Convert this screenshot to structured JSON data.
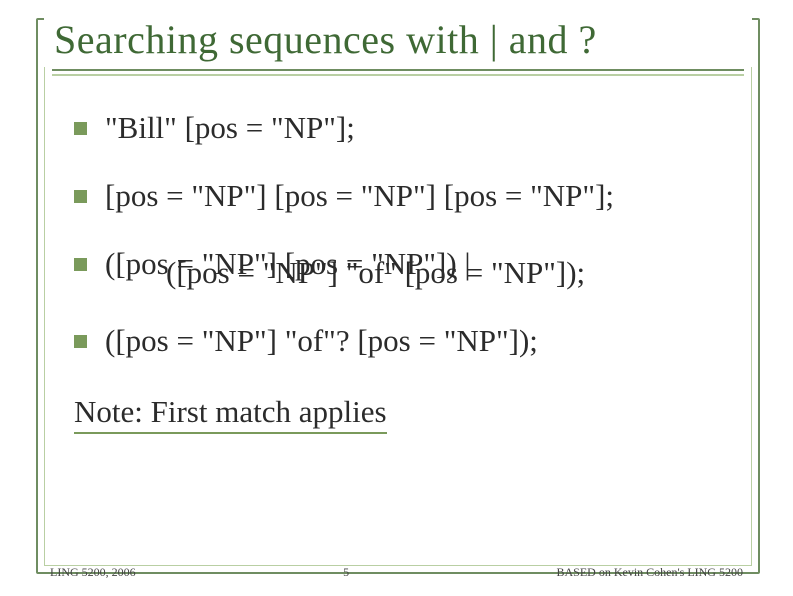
{
  "title": "Searching sequences with | and ?",
  "bullets": [
    "\"Bill\" [pos = \"NP\"];",
    "[pos = \"NP\"] [pos = \"NP\"] [pos = \"NP\"];",
    "([pos = \"NP\"] [pos = \"NP\"]) |",
    "([pos = \"NP\"] \"of\"? [pos = \"NP\"]);"
  ],
  "bullet3_indent": "([pos = \"NP\"] \"of\" [pos = \"NP\"]);",
  "note": "Note: First match applies",
  "footer": {
    "left": "LING 5200, 2006",
    "center": "5",
    "right": "BASED on Kevin Cohen's LING 5200"
  }
}
